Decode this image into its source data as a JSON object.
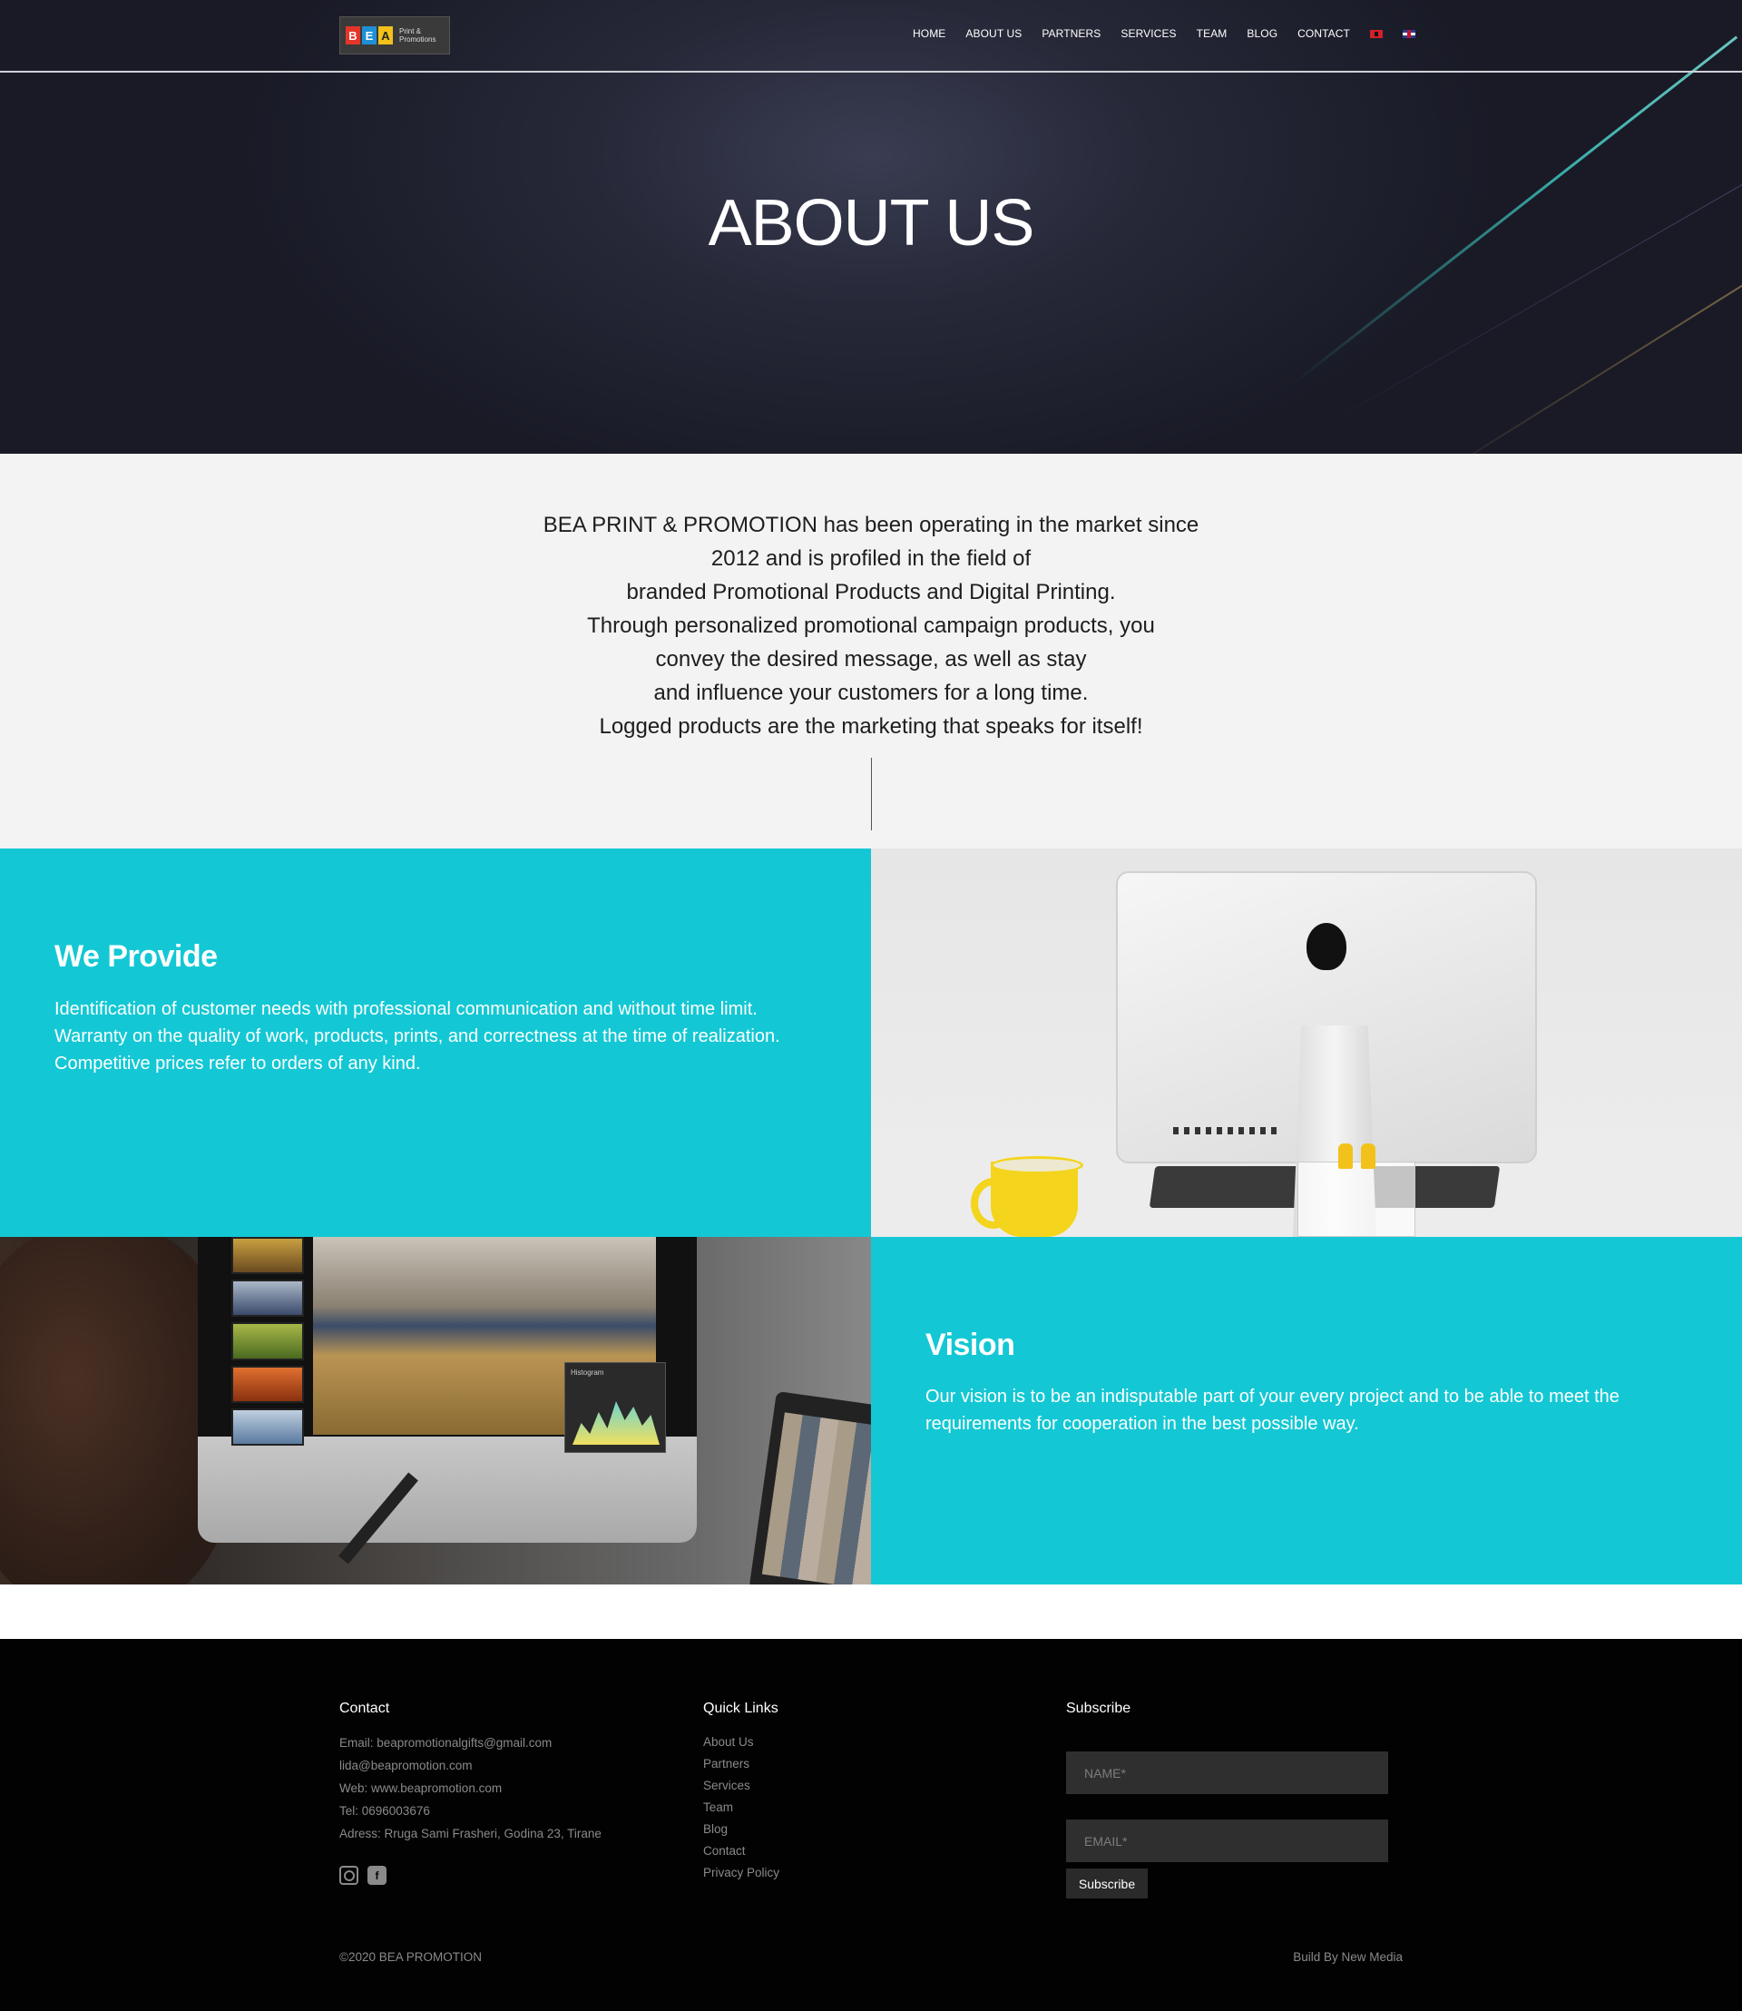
{
  "header": {
    "logo_letters": [
      "B",
      "E",
      "A"
    ],
    "logo_text_line1": "Print &",
    "logo_text_line2": "Promotions",
    "nav": [
      "HOME",
      "ABOUT US",
      "PARTNERS",
      "SERVICES",
      "TEAM",
      "BLOG",
      "CONTACT"
    ],
    "languages": [
      "al-flag",
      "uk-flag"
    ]
  },
  "hero": {
    "title": "ABOUT US"
  },
  "intro": {
    "lines": [
      "BEA PRINT & PROMOTION has been operating in the market since",
      "2012 and is profiled in the field of",
      "branded Promotional Products and Digital Printing.",
      "Through personalized promotional campaign products, you",
      "convey the desired message, as well as stay",
      "and influence your customers for a long time.",
      "Logged products are the marketing that speaks for itself!"
    ]
  },
  "provide": {
    "title": "We Provide",
    "lines": [
      "Identification of customer needs with professional communication and without time limit.",
      "Warranty on the quality of work, products, prints, and correctness at the time of realization.",
      "Competitive prices refer to orders of any kind."
    ]
  },
  "vision": {
    "title": "Vision",
    "text": "Our vision is to be an indisputable part of your every project and to be able to meet the requirements for cooperation in the best possible way.",
    "histogram_label": "Histogram"
  },
  "footer": {
    "contact": {
      "title": "Contact",
      "lines": [
        "Email: beapromotionalgifts@gmail.com",
        "lida@beapromotion.com",
        "Web: www.beapromotion.com",
        "Tel:  0696003676",
        "Adress: Rruga Sami Frasheri, Godina 23, Tirane"
      ]
    },
    "quick_links": {
      "title": "Quick Links",
      "items": [
        "About Us",
        "Partners",
        "Services",
        "Team",
        "Blog",
        "Contact",
        "Privacy Policy"
      ]
    },
    "subscribe": {
      "title": "Subscribe",
      "name_placeholder": "NAME*",
      "email_placeholder": "EMAIL*",
      "button": "Subscribe"
    },
    "copyright": "©2020 BEA PROMOTION",
    "build_by": "Build By New Media"
  },
  "colors": {
    "accent": "#13c8d4",
    "hero_bg": "#262838",
    "footer_bg": "#020202",
    "intro_bg": "#f3f3f3"
  }
}
